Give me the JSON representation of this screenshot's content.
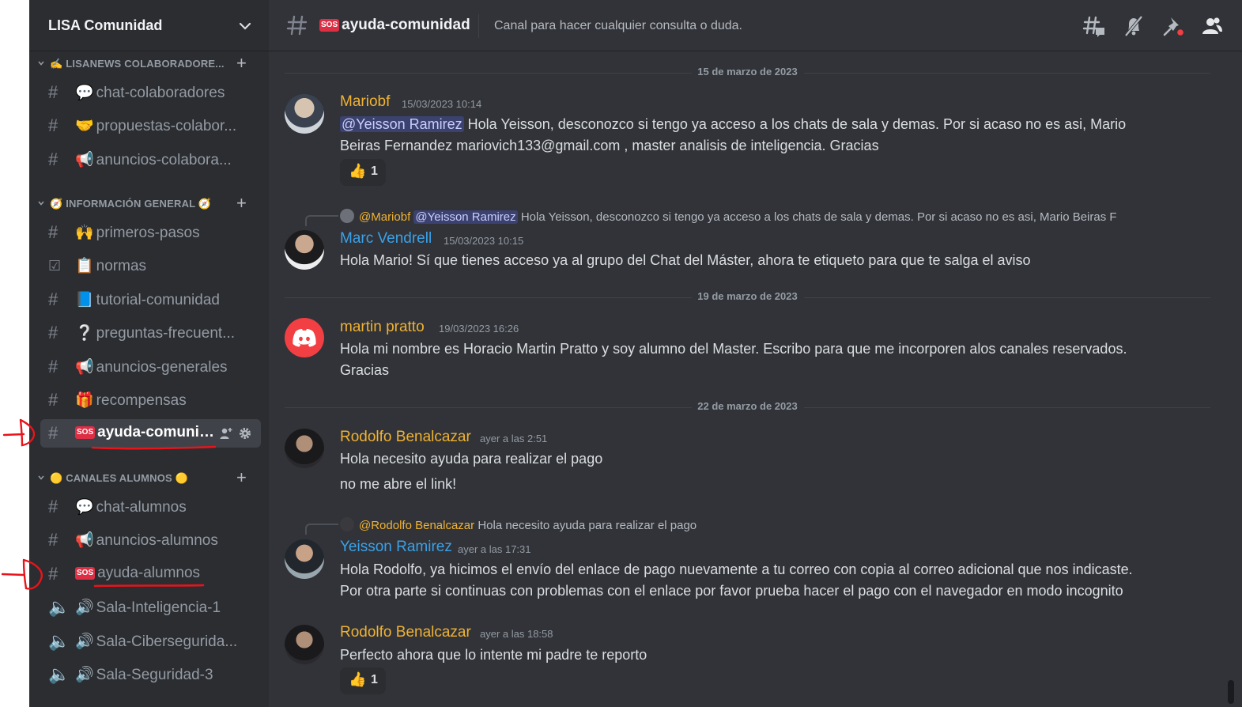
{
  "server": {
    "name": "LISA Comunidad"
  },
  "sidebar": {
    "categories": [
      {
        "label": "✍️ LISANEWS COLABORADORE...",
        "channels": [
          {
            "icon": "locked-hash-icon",
            "emoji": "💬",
            "name": "chat-colaboradores"
          },
          {
            "icon": "locked-hash-icon",
            "emoji": "🤝",
            "name": "propuestas-colabor..."
          },
          {
            "icon": "locked-hash-icon",
            "emoji": "📢",
            "name": "anuncios-colabora..."
          }
        ]
      },
      {
        "label": "🧭 INFORMACIÓN GENERAL 🧭",
        "channels": [
          {
            "icon": "hash-icon",
            "emoji": "🙌",
            "name": "primeros-pasos"
          },
          {
            "icon": "rules-icon",
            "emoji": "📋",
            "name": "normas"
          },
          {
            "icon": "hash-icon",
            "emoji": "📘",
            "name": "tutorial-comunidad"
          },
          {
            "icon": "hash-icon",
            "emoji": "❔",
            "name": "preguntas-frecuent..."
          },
          {
            "icon": "hash-icon",
            "emoji": "📢",
            "name": "anuncios-generales"
          },
          {
            "icon": "hash-icon",
            "emoji": "🎁",
            "name": "recompensas"
          },
          {
            "icon": "hash-icon",
            "emoji": "SOS",
            "name": "ayuda-comunid...",
            "active": true
          }
        ]
      },
      {
        "label": "🟡 CANALES ALUMNOS 🟡",
        "channels": [
          {
            "icon": "locked-hash-icon",
            "emoji": "💬",
            "name": "chat-alumnos"
          },
          {
            "icon": "locked-hash-icon",
            "emoji": "📢",
            "name": "anuncios-alumnos"
          },
          {
            "icon": "locked-hash-icon",
            "emoji": "SOS",
            "name": "ayuda-alumnos"
          },
          {
            "icon": "locked-speaker-icon",
            "emoji": "🔊",
            "name": "Sala-Inteligencia-1"
          },
          {
            "icon": "locked-speaker-icon",
            "emoji": "🔊",
            "name": "Sala-Ciberseguridа..."
          },
          {
            "icon": "locked-speaker-icon",
            "emoji": "🔊",
            "name": "Sala-Seguridad-3"
          }
        ]
      }
    ]
  },
  "header": {
    "channel_emoji": "SOS",
    "channel_name": "ayuda-comunidad",
    "topic": "Canal para hacer cualquier consulta o duda."
  },
  "dividers": [
    "15 de marzo de 2023",
    "19 de marzo de 2023",
    "22 de marzo de 2023"
  ],
  "messages": [
    {
      "author": "Mariobf",
      "color": "#f0b232",
      "time": "15/03/2023 10:14",
      "mention": "@Yeisson Ramirez",
      "line1": " Hola Yeisson, desconozco si tengo ya acceso a los chats de sala y demas. Por si acaso no es asi, Mario",
      "line2": "Beiras Fernandez mariovich133@gmail.com , master analisis de inteligencia. Gracias",
      "reaction": {
        "emoji": "👍",
        "count": "1"
      }
    },
    {
      "author": "Marc Vendrell",
      "color": "#3ba1e8",
      "time": "15/03/2023 10:15",
      "reply_author": "@Mariobf",
      "reply_mention": "@Yeisson Ramirez",
      "reply_text": "Hola Yeisson, desconozco si tengo ya acceso a los chats de sala y demas. Por si acaso no es asi, Mario Beiras F",
      "line1": "Hola Mario! Sí que tienes acceso ya al grupo del Chat del Máster, ahora te etiqueto para que te salga el aviso"
    },
    {
      "author": "martin pratto",
      "color": "#f0b232",
      "time": "19/03/2023 16:26",
      "line1": "Hola mi nombre es Horacio Martin Pratto y soy alumno del Master. Escribo para que me incorporen alos canales reservados.",
      "line2": "Gracias"
    },
    {
      "author": "Rodolfo Benalcazar",
      "color": "#f0b232",
      "time": "ayer a las 2:51",
      "line1": "Hola necesito ayuda para realizar el pago",
      "line2": "no me abre el link!"
    },
    {
      "author": "Yeisson Ramirez",
      "color": "#3ba1e8",
      "time": "ayer a las 17:31",
      "reply_author": "@Rodolfo Benalcazar",
      "reply_text": "Hola necesito ayuda para realizar el pago",
      "line1": "Hola Rodolfo, ya hicimos el envío del enlace de pago nuevamente a tu correo con copia al correo adicional que nos indicaste.",
      "line2": "Por otra parte si continuas con problemas con el enlace por favor prueba hacer el pago con el navegador en modo incognito"
    },
    {
      "author": "Rodolfo Benalcazar",
      "color": "#f0b232",
      "time": "ayer a las 18:58",
      "line1": "Perfecto ahora que lo intente mi padre te reporto",
      "reaction": {
        "emoji": "👍",
        "count": "1"
      }
    }
  ],
  "colors": {
    "bg": "#313338",
    "sidebar": "#2b2d31",
    "mention_bg": "#3c4270",
    "annotation": "#e8141b"
  }
}
